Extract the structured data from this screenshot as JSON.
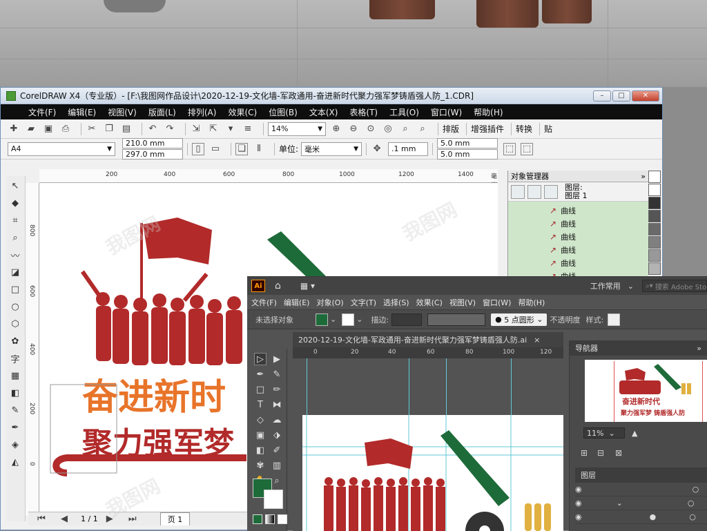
{
  "corel": {
    "title": "CorelDRAW X4（专业版）- [F:\\我图网作品设计\\2020-12-19-文化墙-军政通用-奋进新时代聚力强军梦铸盾强人防_1.CDR]",
    "menu": [
      "文件(F)",
      "编辑(E)",
      "视图(V)",
      "版面(L)",
      "排列(A)",
      "效果(C)",
      "位图(B)",
      "文本(X)",
      "表格(T)",
      "工具(O)",
      "窗口(W)",
      "帮助(H)"
    ],
    "zoom": "14%",
    "toolbar_right": [
      "排版",
      "增强插件",
      "转换",
      "贴"
    ],
    "paper": "A4",
    "width": "210.0 mm",
    "height": "297.0 mm",
    "unit_label": "单位:",
    "unit": "毫米",
    "nudge": ".1 mm",
    "dup_x": "5.0 mm",
    "dup_y": "5.0 mm",
    "hruler_ticks": [
      "200",
      "400",
      "600",
      "800",
      "1000",
      "1200",
      "1400",
      "毫米"
    ],
    "vruler_ticks": [
      "800",
      "600",
      "400",
      "200",
      "0"
    ],
    "page_counter": "1 / 1",
    "page_tab": "页 1",
    "banner_line1": "奋进新时",
    "banner_line2": "聚力强军梦"
  },
  "object_manager": {
    "title": "对象管理器",
    "layer_label": "图层:",
    "layer_name": "图层 1",
    "items": [
      "曲线",
      "曲线",
      "曲线",
      "曲线",
      "曲线",
      "曲线"
    ]
  },
  "ai": {
    "logo": "Ai",
    "workspace": "工作常用",
    "search_placeholder": "搜索 Adobe Stock",
    "menu": [
      "文件(F)",
      "编辑(E)",
      "对象(O)",
      "文字(T)",
      "选择(S)",
      "效果(C)",
      "视图(V)",
      "窗口(W)",
      "帮助(H)"
    ],
    "no_selection": "未选择对象",
    "stroke_label": "描边:",
    "brush": "5 点圆形",
    "opacity_label": "不透明度",
    "style_label": "样式:",
    "doc_tab": "2020-12-19-文化墙-军政通用-奋进新时代聚力强军梦铸盾强人防.ai",
    "ruler_ticks": [
      "0",
      "20",
      "40",
      "60",
      "80",
      "100",
      "120"
    ],
    "navigator_title": "导航器",
    "nav_zoom": "11%",
    "layers_title": "图层",
    "thumb_line1": "奋进新时代",
    "thumb_line2": "聚力强军梦   铸盾强人防"
  },
  "colors": {
    "red": "#b22a2a",
    "orange": "#e8742a",
    "green": "#1e6b3a"
  }
}
